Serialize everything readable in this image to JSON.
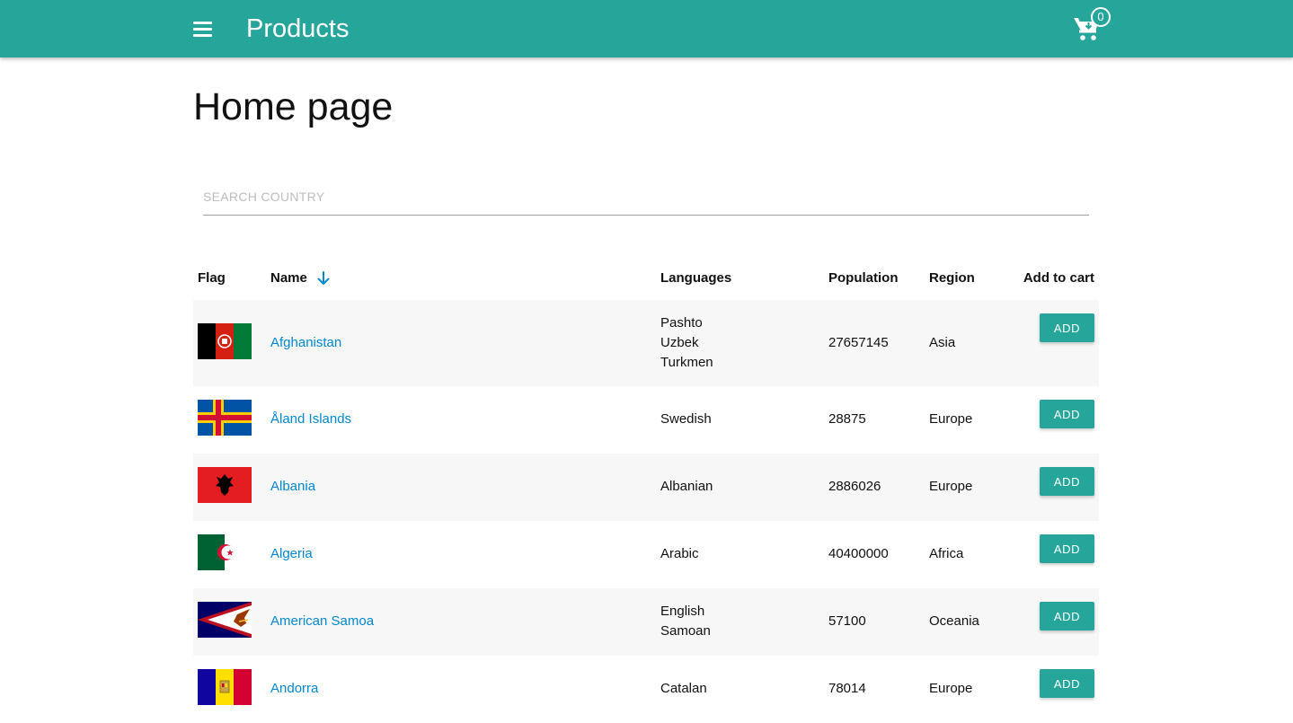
{
  "appbar": {
    "title": "Products",
    "menu_icon": "hamburger-menu-icon",
    "cart_icon": "shopping-cart-icon",
    "cart_count": "0",
    "color": "#26a69a"
  },
  "page": {
    "title": "Home page"
  },
  "search": {
    "placeholder": "SEARCH COUNTRY",
    "value": ""
  },
  "table": {
    "headers": {
      "flag": "Flag",
      "name": "Name",
      "languages": "Languages",
      "population": "Population",
      "region": "Region",
      "add_to_cart": "Add to cart"
    },
    "sort_icon": "arrow-down-icon",
    "rows": [
      {
        "name": "Afghanistan",
        "flag": "afghanistan-flag-icon",
        "languages": [
          "Pashto",
          "Uzbek",
          "Turkmen"
        ],
        "population": "27657145",
        "region": "Asia",
        "button": "ADD"
      },
      {
        "name": "Åland Islands",
        "flag": "aland-islands-flag-icon",
        "languages": [
          "Swedish"
        ],
        "population": "28875",
        "region": "Europe",
        "button": "ADD"
      },
      {
        "name": "Albania",
        "flag": "albania-flag-icon",
        "languages": [
          "Albanian"
        ],
        "population": "2886026",
        "region": "Europe",
        "button": "ADD"
      },
      {
        "name": "Algeria",
        "flag": "algeria-flag-icon",
        "languages": [
          "Arabic"
        ],
        "population": "40400000",
        "region": "Africa",
        "button": "ADD"
      },
      {
        "name": "American Samoa",
        "flag": "american-samoa-flag-icon",
        "languages": [
          "English",
          "Samoan"
        ],
        "population": "57100",
        "region": "Oceania",
        "button": "ADD"
      },
      {
        "name": "Andorra",
        "flag": "andorra-flag-icon",
        "languages": [
          "Catalan"
        ],
        "population": "78014",
        "region": "Europe",
        "button": "ADD"
      }
    ]
  }
}
